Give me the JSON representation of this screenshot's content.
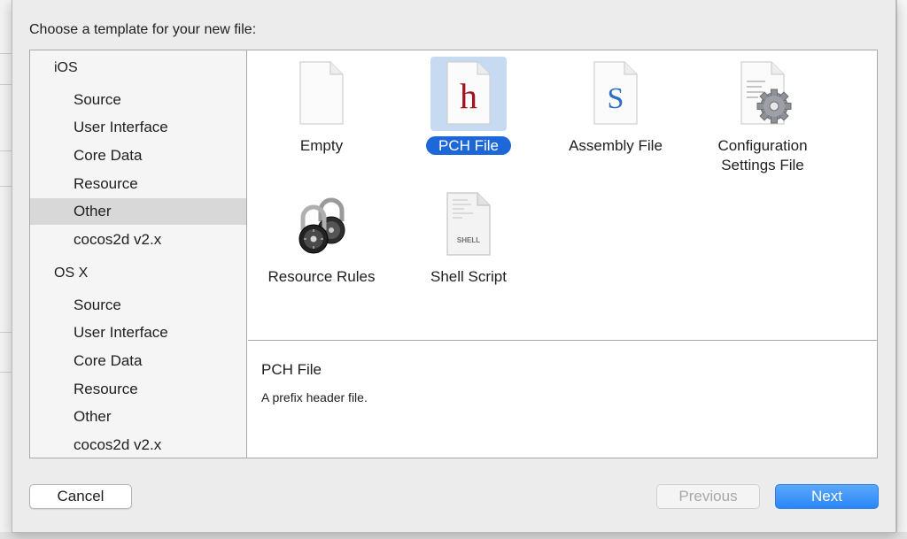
{
  "dialog": {
    "prompt": "Choose a template for your new file:"
  },
  "categories": {
    "groups": [
      {
        "header": "iOS",
        "items": [
          "Source",
          "User Interface",
          "Core Data",
          "Resource",
          "Other",
          "cocos2d v2.x"
        ]
      },
      {
        "header": "OS X",
        "items": [
          "Source",
          "User Interface",
          "Core Data",
          "Resource",
          "Other",
          "cocos2d v2.x"
        ]
      }
    ],
    "selected": "iOS / Other"
  },
  "templates": {
    "items": [
      {
        "label": "Empty",
        "icon": "blank-document-icon"
      },
      {
        "label": "PCH File",
        "icon": "header-file-icon",
        "glyph": "h",
        "selected": true
      },
      {
        "label": "Assembly File",
        "icon": "assembly-file-icon",
        "glyph": "S"
      },
      {
        "label": "Configuration\nSettings File",
        "label_line1": "Configuration",
        "label_line2": "Settings File",
        "icon": "settings-file-icon"
      },
      {
        "label": "Resource Rules",
        "icon": "padlocks-icon"
      },
      {
        "label": "Shell Script",
        "icon": "shell-script-icon",
        "glyph": "SHELL"
      }
    ]
  },
  "description": {
    "title": "PCH File",
    "text": "A prefix header file."
  },
  "buttons": {
    "cancel": "Cancel",
    "previous": "Previous",
    "next": "Next"
  },
  "colors": {
    "accent": "#1d67d8",
    "selection_tile": "#c6daf2",
    "sidebar_selection": "#d8d8d8",
    "next_button": "#2a86f8",
    "header_glyph": "#a3121f",
    "assembly_glyph": "#2e6fc4"
  }
}
